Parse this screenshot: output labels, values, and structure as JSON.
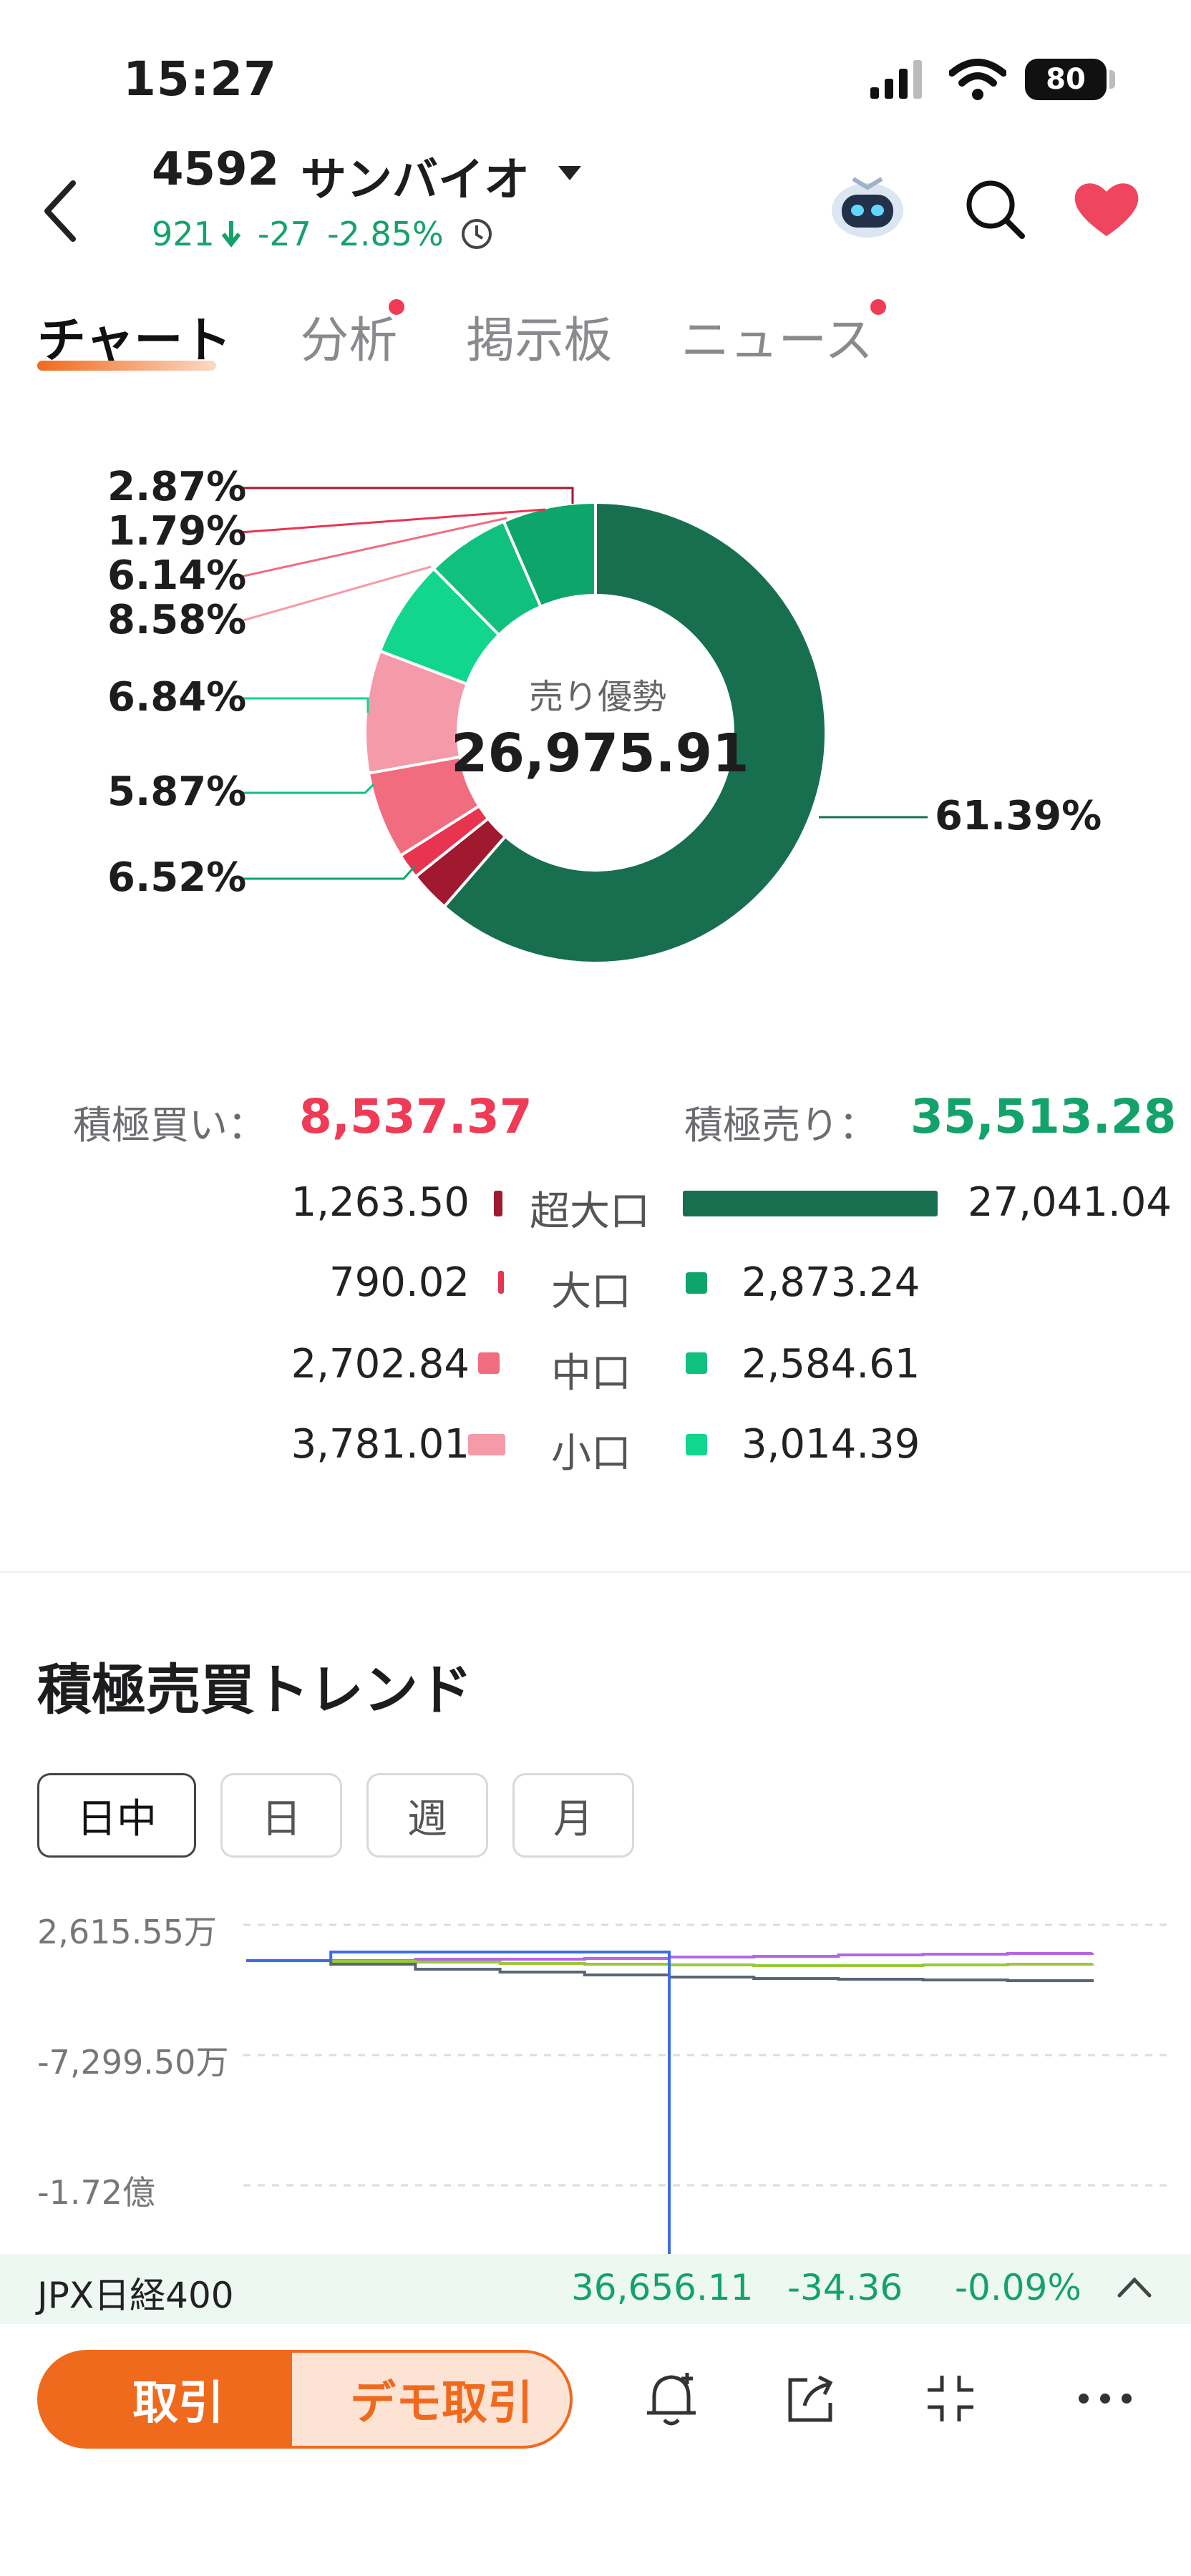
{
  "status_bar": {
    "time": "15:27",
    "battery": "80"
  },
  "header": {
    "code": "4592",
    "name": "サンバイオ",
    "price": "921",
    "change": "-27",
    "change_pct": "-2.85%"
  },
  "tabs": [
    {
      "label": "チャート",
      "active": true,
      "dot": false
    },
    {
      "label": "分析",
      "active": false,
      "dot": true
    },
    {
      "label": "掲示板",
      "active": false,
      "dot": false
    },
    {
      "label": "ニュース",
      "active": false,
      "dot": true
    }
  ],
  "donut": {
    "center_label": "売り優勢",
    "center_value": "26,975.91",
    "labels": {
      "buy_xlarge": "2.87%",
      "buy_large": "1.79%",
      "buy_medium": "6.14%",
      "buy_small": "8.58%",
      "sell_small": "6.84%",
      "sell_medium": "5.87%",
      "sell_large": "6.52%",
      "sell_xlarge": "61.39%"
    }
  },
  "chart_data": [
    {
      "type": "pie",
      "title": "",
      "categories": [
        "超大口(買)",
        "大口(買)",
        "中口(買)",
        "小口(買)",
        "小口(売)",
        "中口(売)",
        "大口(売)",
        "超大口(売)"
      ],
      "values": [
        2.87,
        1.79,
        6.14,
        8.58,
        6.84,
        5.87,
        6.52,
        61.39
      ],
      "colors": [
        "#a0192e",
        "#e8344f",
        "#f26c80",
        "#f59aa8",
        "#12d58e",
        "#10c07e",
        "#0ea56b",
        "#176f4f"
      ]
    },
    {
      "type": "line",
      "title": "積極売買トレンド",
      "y_tick_labels": [
        "2,615.55万",
        "-7,299.50万",
        "-1.72億"
      ],
      "series": [
        {
          "color": "#b567e6",
          "values": [
            0,
            0,
            0.2,
            0.2,
            0.3,
            0.5,
            0.6,
            0.8,
            0.9,
            1.0,
            1.1
          ]
        },
        {
          "color": "#9bc83a",
          "values": [
            0,
            -0.1,
            -0.2,
            -0.4,
            -0.5,
            -0.6,
            -0.7,
            -0.7,
            -0.6,
            -0.5,
            -0.4
          ]
        },
        {
          "color": "#5a6678",
          "values": [
            0,
            -0.5,
            -1.2,
            -1.6,
            -2.0,
            -2.3,
            -2.5,
            -2.6,
            -2.7,
            -2.8,
            -2.6
          ]
        },
        {
          "color": "#3d6de0",
          "values": [
            0,
            1.2,
            1.2,
            1.2,
            1.2,
            -20,
            null,
            null,
            null,
            null,
            null
          ]
        }
      ]
    }
  ],
  "summary": {
    "buy_label": "積極買い：",
    "buy_total": "8,537.37",
    "sell_label": "積極売り：",
    "sell_total": "35,513.28",
    "rows": [
      {
        "buy": "1,263.50",
        "label": "超大口",
        "sell": "27,041.04",
        "buy_color": "#a0192e",
        "sell_color": "#176f4f"
      },
      {
        "buy": "790.02",
        "label": "大口",
        "sell": "2,873.24",
        "buy_color": "#e8344f",
        "sell_color": "#0ea56b"
      },
      {
        "buy": "2,702.84",
        "label": "中口",
        "sell": "2,584.61",
        "buy_color": "#f26c80",
        "sell_color": "#10c07e"
      },
      {
        "buy": "3,781.01",
        "label": "小口",
        "sell": "3,014.39",
        "buy_color": "#f59aa8",
        "sell_color": "#12d58e"
      }
    ]
  },
  "trend": {
    "title": "積極売買トレンド",
    "ranges": [
      "日中",
      "日",
      "週",
      "月"
    ],
    "y_labels": [
      "2,615.55万",
      "-7,299.50万",
      "-1.72億"
    ]
  },
  "ticker": {
    "name": "JPX日経400",
    "value": "36,656.11",
    "change": "-34.36",
    "pct": "-0.09%"
  },
  "bottom_bar": {
    "trade_label": "取引",
    "demo_label": "デモ取引"
  }
}
